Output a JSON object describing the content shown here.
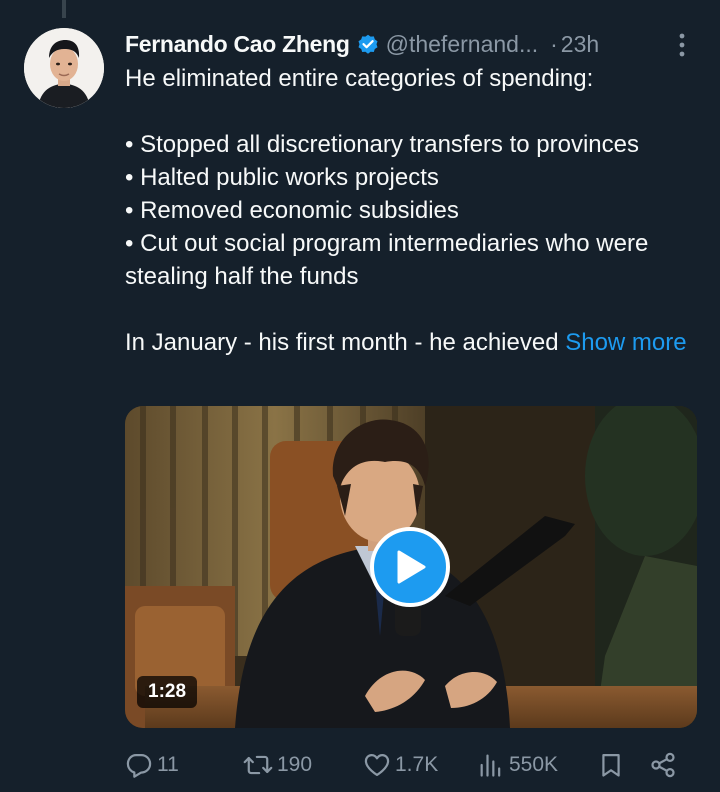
{
  "tweet": {
    "author_name": "Fernando Cao Zheng",
    "handle": "@thefernand...",
    "separator": "·",
    "time": "23h",
    "text": {
      "intro": "He eliminated entire categories of spending:",
      "bullets": [
        "• Stopped all discretionary transfers to provinces",
        "• Halted public works projects",
        "• Removed economic subsidies",
        "• Cut out social program intermediaries who were stealing half the funds"
      ],
      "closing": "In January - his first month - he achieved",
      "show_more": "Show more"
    },
    "media": {
      "duration": "1:28"
    },
    "stats": {
      "replies": "11",
      "reposts": "190",
      "likes": "1.7K",
      "views": "550K"
    }
  },
  "colors": {
    "background": "#15202b",
    "text": "#f7f9f9",
    "muted": "#8b98a5",
    "accent": "#1d9bf0"
  },
  "icons": {
    "verified": "verified-badge-icon",
    "more": "more-vertical-icon",
    "reply": "reply-icon",
    "repost": "repost-icon",
    "like": "heart-icon",
    "views": "views-chart-icon",
    "bookmark": "bookmark-icon",
    "share": "share-icon",
    "play": "play-icon"
  }
}
